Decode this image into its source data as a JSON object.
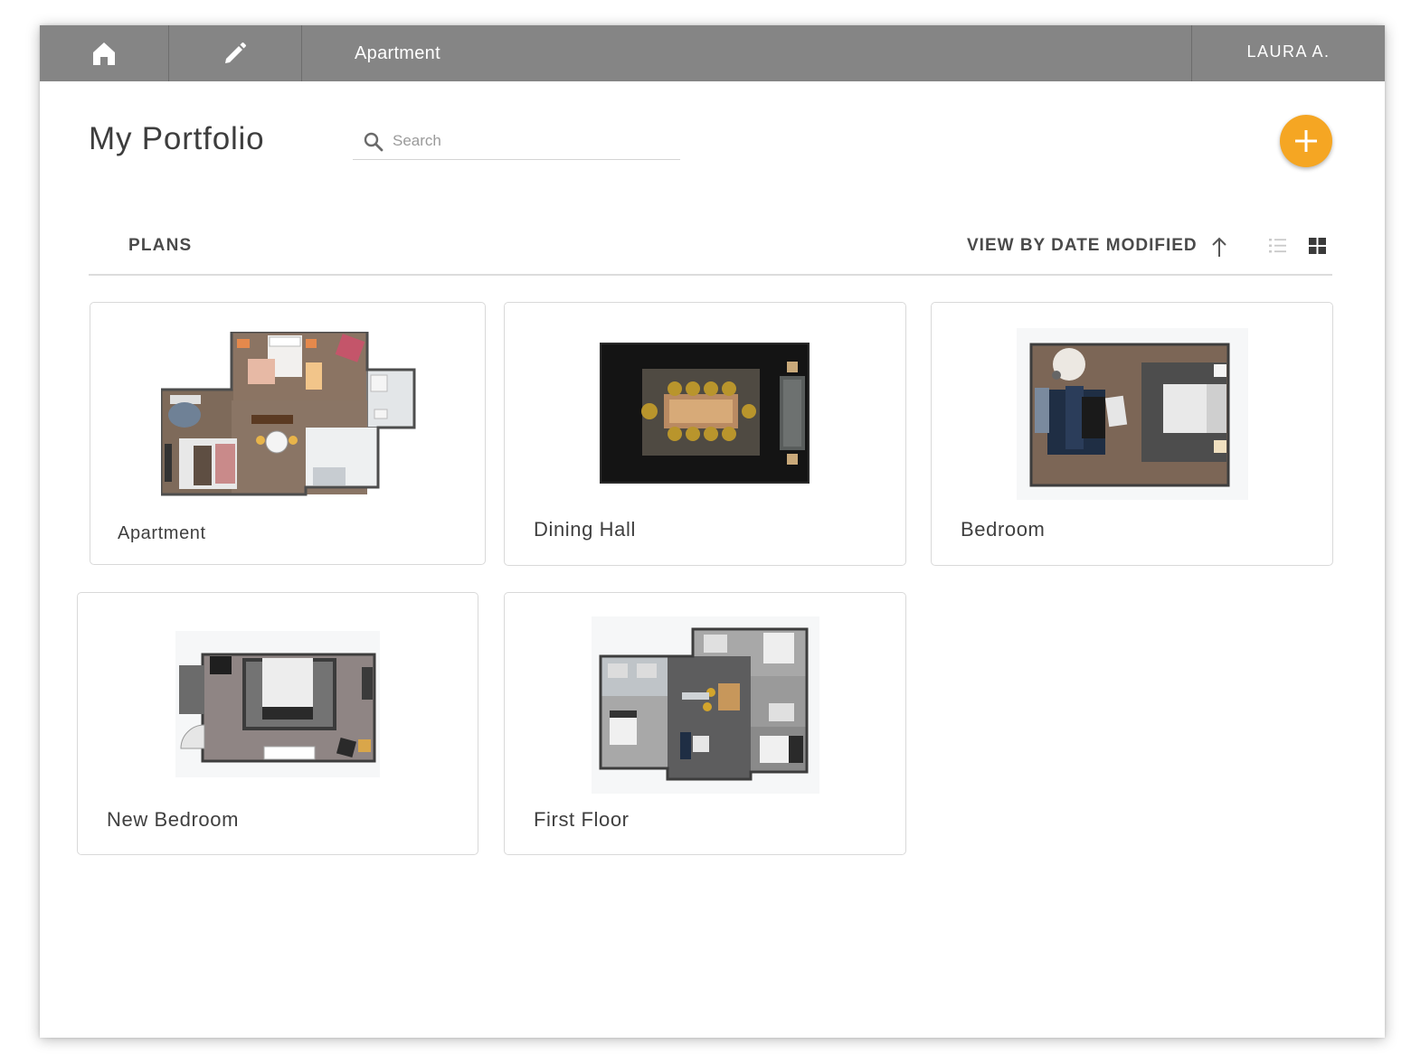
{
  "topbar": {
    "home_icon": "home-icon",
    "edit_icon": "pencil-icon",
    "project_title": "Apartment",
    "user_name": "LAURA A."
  },
  "header": {
    "title": "My Portfolio",
    "search_placeholder": "Search",
    "search_value": "",
    "add_icon": "plus-icon"
  },
  "toolbar": {
    "section_label": "PLANS",
    "sort_label": "VIEW BY DATE MODIFIED",
    "sort_direction": "ascending",
    "views": [
      "list-view-icon",
      "grid-view-icon"
    ],
    "active_view": "grid"
  },
  "colors": {
    "topbar": "#858585",
    "accent": "#f5a623",
    "text": "#3f3f3f"
  },
  "plans": [
    {
      "name": "Apartment"
    },
    {
      "name": "Dining Hall"
    },
    {
      "name": "Bedroom"
    },
    {
      "name": "New Bedroom"
    },
    {
      "name": "First Floor"
    }
  ]
}
